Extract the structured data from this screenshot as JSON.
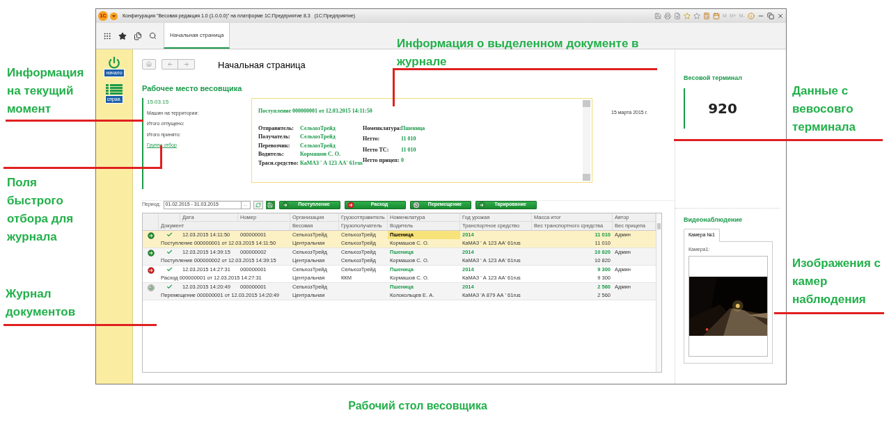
{
  "window": {
    "logo": "1С",
    "title": "Конфигурация \"Весовая редакция 1.0 (1.0.0.0)\" на платформе 1С:Предприятие 8.3   (1С:Предприятие)",
    "memory_buttons": [
      "M",
      "M+",
      "M-"
    ]
  },
  "tabs": [
    {
      "label": "Начальная страница",
      "selected": true
    }
  ],
  "sidebar": {
    "items": [
      {
        "kind": "power",
        "label": "начало"
      },
      {
        "kind": "list",
        "label": "справ."
      }
    ]
  },
  "page_title": "Начальная страница",
  "workplace": {
    "title": "Рабочее место весовщика",
    "date": "15.03.15",
    "fields": [
      "Машин на территории:",
      "Итого отпущено:",
      "Итого принято:"
    ],
    "link": "Группа отбор"
  },
  "info": {
    "heading": "Поступление 000000001 от 12.03.2015 14:11:50",
    "left": [
      {
        "label": "Отправитель:",
        "value": "СельхозТрейд"
      },
      {
        "label": "Получатель:",
        "value": "СельхозТрейд"
      },
      {
        "label": "Перевозчик:",
        "value": "СельхозТрейд"
      },
      {
        "label": "Водитель:",
        "value": "Кормашов С. О."
      },
      {
        "label": "Трасн.средство:",
        "value": "КаМАЗ ' А 123 АА' 61rus"
      }
    ],
    "right": [
      {
        "label": "Номенклатура:",
        "value": "Пшеница"
      },
      {
        "label": "Нетто:",
        "value": "11 010"
      },
      {
        "label": "Нетто ТС:",
        "value": "11 010"
      },
      {
        "label": "Нетто прицеп:",
        "value": "0"
      }
    ]
  },
  "current_date": "15 марта 2015 г.",
  "filter": {
    "label": "Период:",
    "value": "01.02.2015 - 31.03.2015",
    "choose_button": "...",
    "buttons": [
      {
        "kind": "in",
        "label": "Поступление"
      },
      {
        "kind": "out",
        "label": "Расход"
      },
      {
        "kind": "move",
        "label": "Перемещение"
      },
      {
        "kind": "tare",
        "label": "Тарирование"
      }
    ]
  },
  "table": {
    "columns_top": [
      "Дата",
      "Номер",
      "Организация",
      "Грузоотправитель",
      "Номенклатура",
      "Год урожая",
      "Масса итог",
      "Автор"
    ],
    "columns_bottom": [
      "Документ",
      "Весовая",
      "Грузополучатель",
      "Водитель",
      "Транспортное средство",
      "Вес транспортного средства",
      "Вес прицепа"
    ],
    "rows": [
      {
        "kind": "in",
        "selected": true,
        "posted": true,
        "date": "12.03.2015 14:11:50",
        "number": "000000001",
        "organization": "СельхозТрейд",
        "sender": "СельхозТрейд",
        "item": "Пшеница",
        "year": "2014",
        "mass": "11 010",
        "author": "Админ",
        "document": "Поступление 000000001 от 12.03.2015 14:11:50",
        "scale": "Центральная",
        "receiver": "СельхозТрейд",
        "driver": "Кормашов С. О.",
        "vehicle": "КаМАЗ ' А 123 АА' 61rus",
        "vehicle_weight": "11 010"
      },
      {
        "kind": "in",
        "selected": false,
        "posted": true,
        "date": "12.03.2015 14:39:15",
        "number": "000000002",
        "organization": "СельхозТрейд",
        "sender": "СельхозТрейд",
        "item": "Пшеница",
        "year": "2014",
        "mass": "10 820",
        "author": "Админ",
        "document": "Поступление 000000002 от 12.03.2015 14:39:15",
        "scale": "Центральная",
        "receiver": "СельхозТрейд",
        "driver": "Кормашов С. О.",
        "vehicle": "КаМАЗ ' А 123 АА' 61rus",
        "vehicle_weight": "10 820"
      },
      {
        "kind": "out",
        "selected": false,
        "posted": true,
        "date": "12.03.2015 14:27:31",
        "number": "000000001",
        "organization": "СельхозТрейд",
        "sender": "СельхозТрейд",
        "item": "Пшеница",
        "year": "2014",
        "mass": "9 300",
        "author": "Админ",
        "document": "Расход 000000001 от 12.03.2015 14:27:31",
        "scale": "Центральная",
        "receiver": "ККМ",
        "driver": "Кормашов С. О.",
        "vehicle": "КаМАЗ ' А 123 АА' 61rus",
        "vehicle_weight": "9 300"
      },
      {
        "kind": "move",
        "selected": false,
        "posted": true,
        "date": "12.03.2015 14:20:49",
        "number": "000000001",
        "organization": "СельхозТрейд",
        "item": "Пшеница",
        "year": "2014",
        "mass": "2 560",
        "author": "Админ",
        "document": "Перемещение 000000001 от 12.03.2015 14:20:49",
        "scale": "Центральная",
        "driver": "Колокольцев Е. А.",
        "vehicle": "КаМАЗ 'А 879 АА ' 61rus",
        "vehicle_weight": "2 560"
      }
    ]
  },
  "terminal": {
    "title": "Весовой терминал",
    "value": "920"
  },
  "video": {
    "title": "Видеонаблюдение",
    "tabs": [
      {
        "label": "Камера №1",
        "selected": true
      }
    ],
    "camera_label": "Камера1:"
  },
  "annotations": [
    "Информация на текущий момент",
    "Поля быстрого отбора для журнала",
    "Журнал документов",
    "Информация о выделенном документе в журнале",
    "Данные с вевосовго терминала",
    "Изображения с камер наблюдения"
  ],
  "caption": "Рабочий стол весовщика"
}
